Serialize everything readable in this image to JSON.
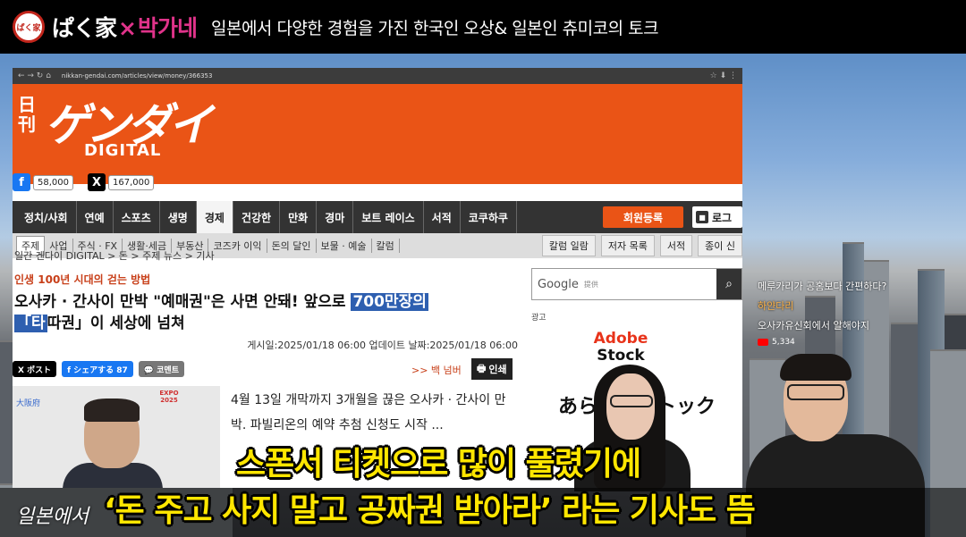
{
  "banner": {
    "logo_text": "ぱく家",
    "brand_pak": "ぱく家",
    "brand_x": "×",
    "brand_park": "박가네",
    "tagline": "일본에서 다양한 경험을 가진 한국인 오상& 일본인 츄미코의 토크"
  },
  "browser": {
    "nav_icons": "← → ↻ ⌂",
    "url": "nikkan-gendai.com/articles/view/money/366353",
    "tool_icons": "☆ ⬇ ⋮"
  },
  "site": {
    "logo_kanji": "日刊",
    "logo_main": "ゲンダイ",
    "logo_sub": "DIGITAL",
    "facebook_count": "58,000",
    "x_count": "167,000",
    "nav": [
      "정치/사회",
      "연예",
      "스포츠",
      "생명",
      "경제",
      "건강한",
      "만화",
      "경마",
      "보트 레이스",
      "서적",
      "코쿠하쿠"
    ],
    "register": "회원등록",
    "login": "로그",
    "subnav": [
      "주제",
      "사업",
      "주식 · FX",
      "생활·세금",
      "부동산",
      "코즈카 이익",
      "돈의 달인",
      "보물 · 예술",
      "칼럼"
    ],
    "subnav_right": [
      "칼럼 일람",
      "저자 목록",
      "서적",
      "종이 신"
    ]
  },
  "article": {
    "breadcrumb": "일간 겐다이 DIGITAL > 돈 > 주제 뉴스 > 기사",
    "kicker": "인생 100년 시대의 걷는 방법",
    "headline_a": "오사카 · 간사이 만박 \"예매권\"은 사면 안돼! 앞으로 ",
    "headline_hl": "700만장의",
    "headline_hl2": "「타",
    "headline_b": "따권」이 세상에 넘쳐",
    "dates": "게시일:2025/01/18 06:00   업데이트 날짜:2025/01/18 06:00",
    "share_x": "X ポスト",
    "share_fb": "f シェアする 87",
    "share_comment": "💬 코멘트",
    "back": ">> 백 넘버",
    "print": "인쇄",
    "photo_left": "大阪府",
    "photo_expo": "EXPO 2025",
    "body": "4월 13일 개막까지 3개월을 끊은 오사카 · 간사이 만박. 파빌리온의 예약 추첨 신청도 시작 ..."
  },
  "sidebar": {
    "search_brand": "Google",
    "search_sub": "提供",
    "ad_label": "광고",
    "ad_brand": "Adobe",
    "ad_stock": "Stock",
    "ad_jp": "あらゆるストック"
  },
  "suggest": {
    "question": "메루카리가 공홈보다 간편하다?",
    "name": "하얀다리",
    "channel": "오사카유신회에서 알해야지",
    "views": "5,334"
  },
  "subtitles": {
    "line1": "스폰서 티켓으로 많이 풀렸기에",
    "line2": "‘돈 주고 사지 말고 공짜권 받아라’ 라는 기사도 뜸",
    "side": "일본에서"
  }
}
